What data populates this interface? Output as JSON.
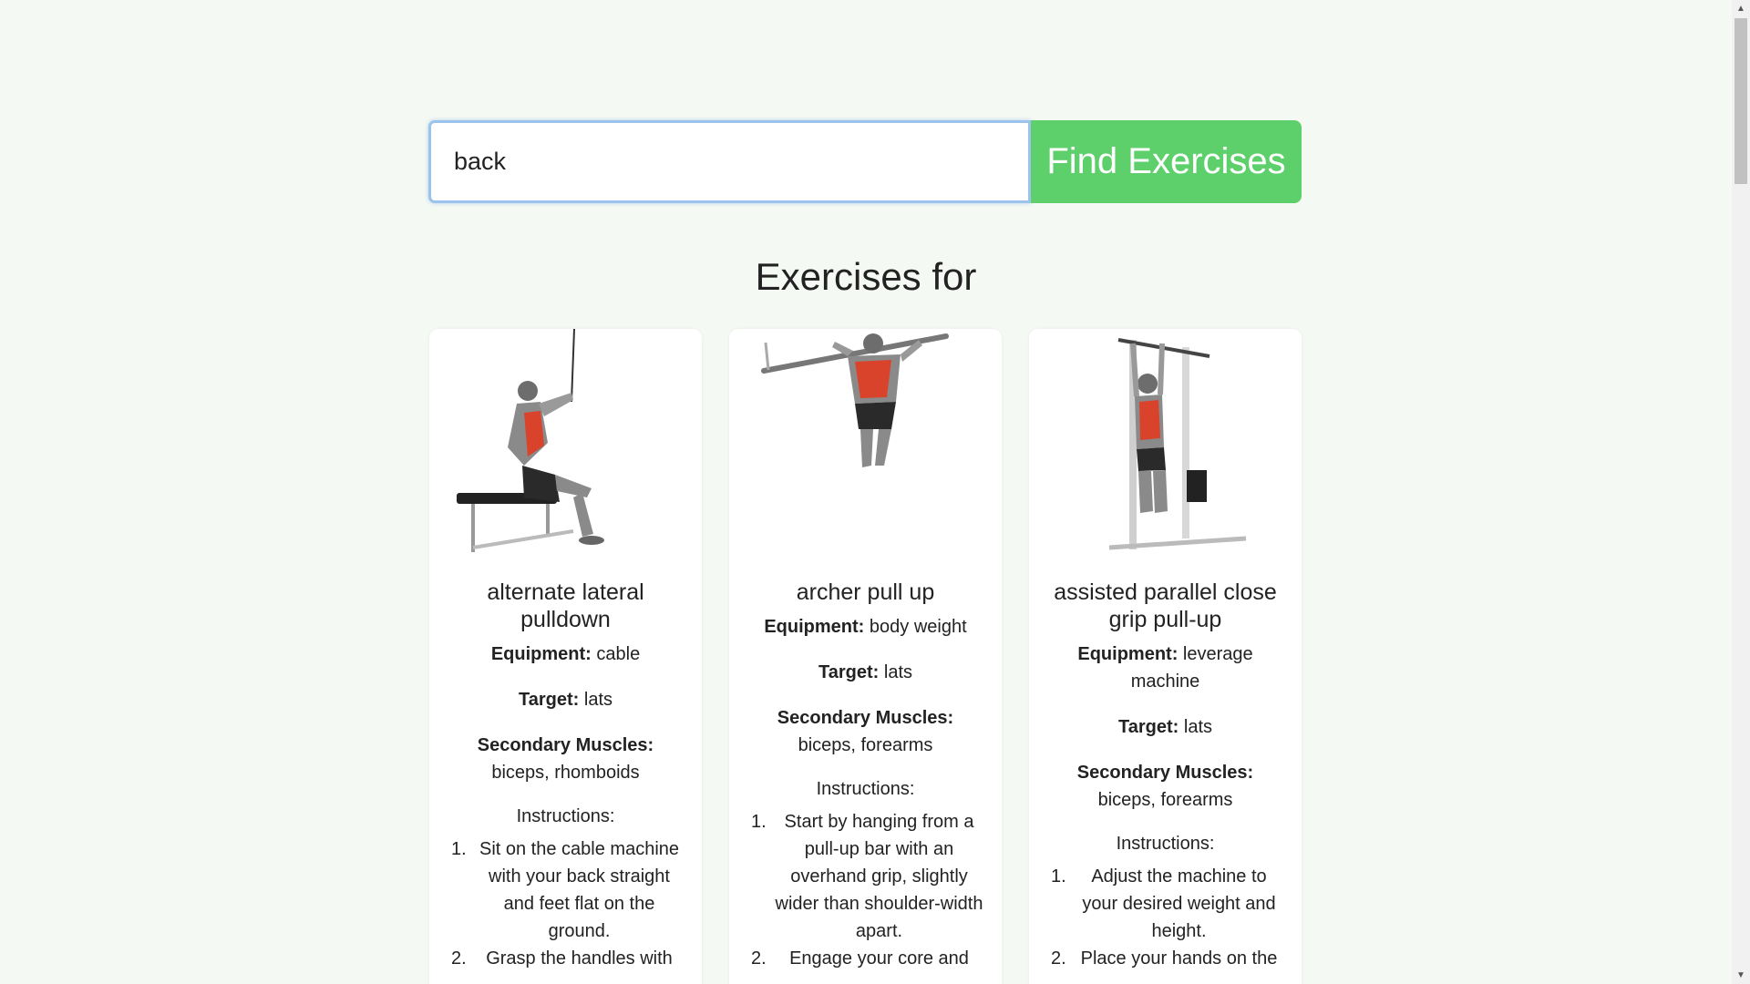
{
  "search": {
    "value": "back",
    "button_label": "Find Exercises"
  },
  "results_title": "Exercises for",
  "labels": {
    "equipment": "Equipment:",
    "target": "Target:",
    "secondary": "Secondary Muscles:",
    "instructions": "Instructions:"
  },
  "exercises": [
    {
      "name": "alternate lateral pulldown",
      "equipment": "cable",
      "target": "lats",
      "secondary": "biceps, rhomboids",
      "instructions": [
        "Sit on the cable machine with your back straight and feet flat on the ground.",
        "Grasp the handles with"
      ]
    },
    {
      "name": "archer pull up",
      "equipment": "body weight",
      "target": "lats",
      "secondary": "biceps, forearms",
      "instructions": [
        "Start by hanging from a pull-up bar with an overhand grip, slightly wider than shoulder-width apart.",
        "Engage your core and"
      ]
    },
    {
      "name": "assisted parallel close grip pull-up",
      "equipment": "leverage machine",
      "target": "lats",
      "secondary": "biceps, forearms",
      "instructions": [
        "Adjust the machine to your desired weight and height.",
        "Place your hands on the"
      ]
    }
  ],
  "colors": {
    "accent": "#5dd06b",
    "background": "#f5f9f3",
    "muscle": "#d9432c"
  }
}
